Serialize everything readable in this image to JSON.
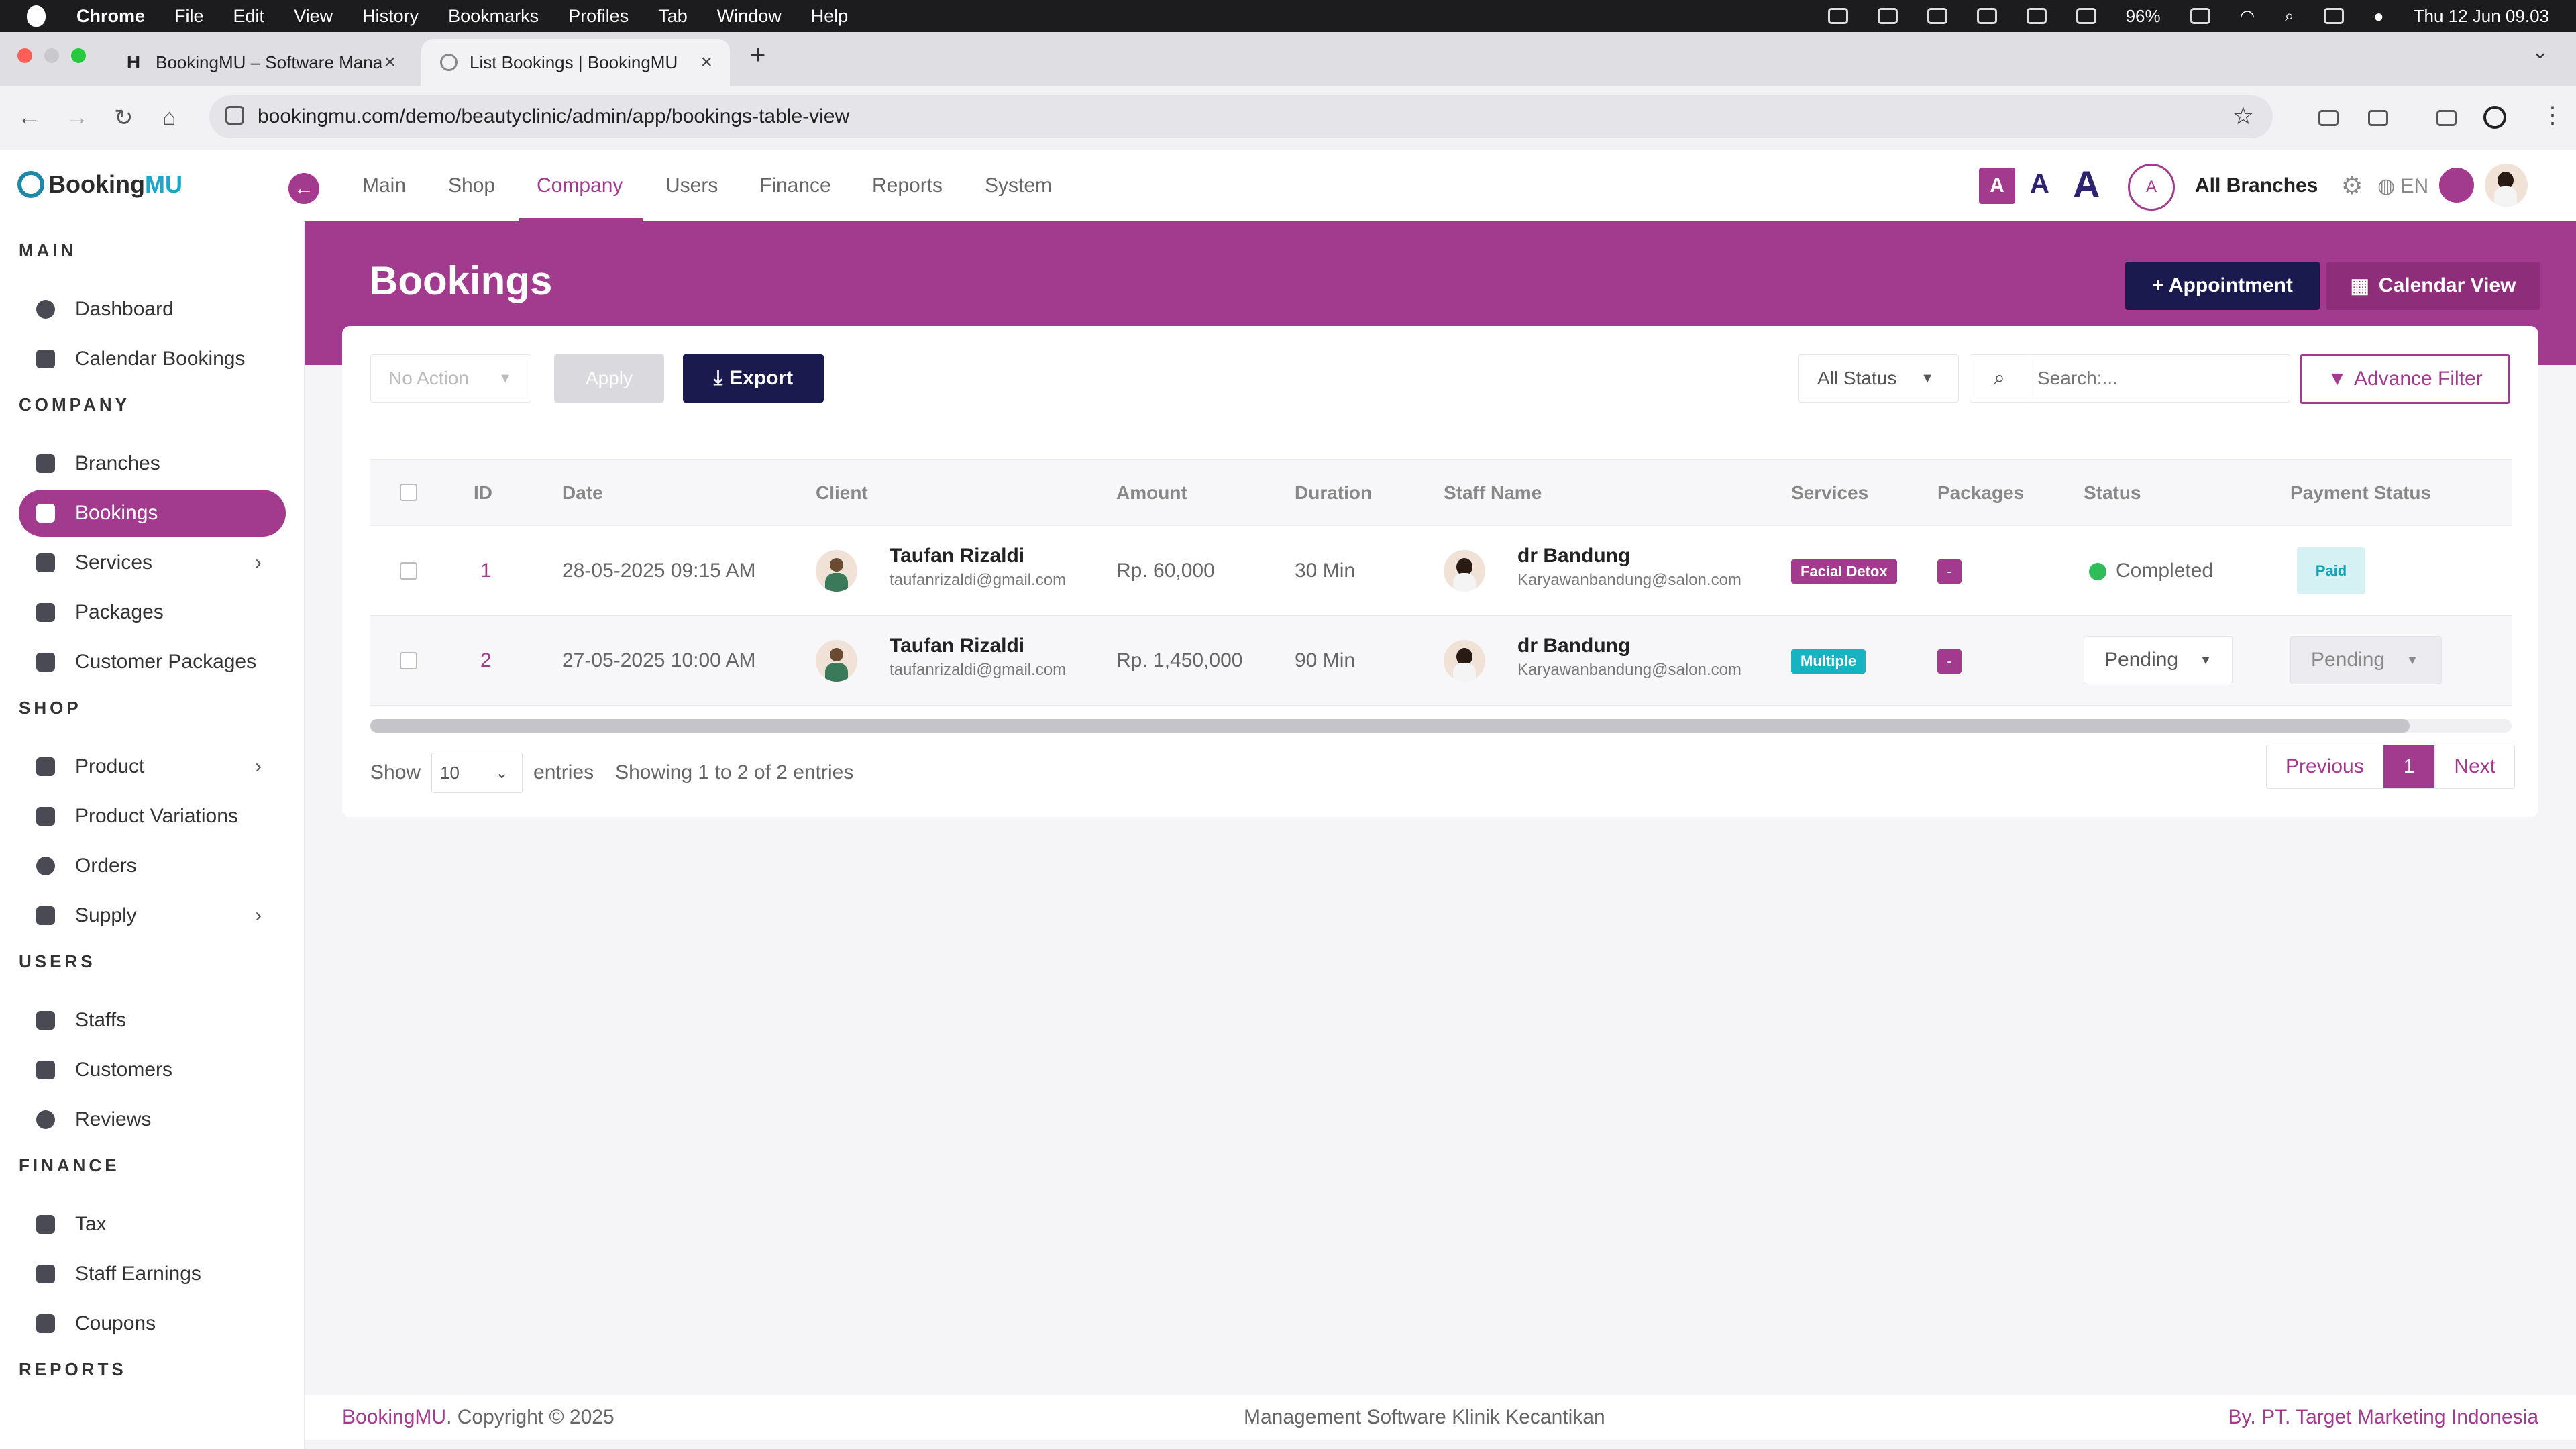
{
  "menubar": {
    "app": "Chrome",
    "items": [
      "File",
      "Edit",
      "View",
      "History",
      "Bookmarks",
      "Profiles",
      "Tab",
      "Window",
      "Help"
    ],
    "battery": "96%",
    "datetime": "Thu 12 Jun  09.03"
  },
  "browser": {
    "tabs": [
      {
        "title": "BookingMU – Software Mana",
        "icon": "H"
      },
      {
        "title": "List Bookings | BookingMU",
        "icon": "globe"
      }
    ],
    "url": "bookingmu.com/demo/beautyclinic/admin/app/bookings-table-view"
  },
  "header": {
    "logo_a": "Booking",
    "logo_b": "MU",
    "nav": [
      "Main",
      "Shop",
      "Company",
      "Users",
      "Finance",
      "Reports",
      "System"
    ],
    "active_nav": "Company",
    "font_sizes": [
      "A",
      "A",
      "A"
    ],
    "branch_initial": "A",
    "branch_label": "All Branches",
    "lang": "EN"
  },
  "sidebar": {
    "sections": [
      {
        "title": "MAIN",
        "items": [
          {
            "label": "Dashboard"
          },
          {
            "label": "Calendar Bookings"
          }
        ]
      },
      {
        "title": "COMPANY",
        "items": [
          {
            "label": "Branches"
          },
          {
            "label": "Bookings",
            "active": true
          },
          {
            "label": "Services",
            "chevron": true
          },
          {
            "label": "Packages"
          },
          {
            "label": "Customer Packages"
          }
        ]
      },
      {
        "title": "SHOP",
        "items": [
          {
            "label": "Product",
            "chevron": true
          },
          {
            "label": "Product Variations"
          },
          {
            "label": "Orders"
          },
          {
            "label": "Supply",
            "chevron": true
          }
        ]
      },
      {
        "title": "USERS",
        "items": [
          {
            "label": "Staffs"
          },
          {
            "label": "Customers"
          },
          {
            "label": "Reviews"
          }
        ]
      },
      {
        "title": "FINANCE",
        "items": [
          {
            "label": "Tax"
          },
          {
            "label": "Staff Earnings"
          },
          {
            "label": "Coupons"
          }
        ]
      },
      {
        "title": "REPORTS",
        "items": []
      }
    ]
  },
  "page": {
    "title": "Bookings",
    "appointment_btn": "+ Appointment",
    "calendar_btn": "Calendar View"
  },
  "toolbar": {
    "bulk_action": "No Action",
    "apply": "Apply",
    "export": "Export",
    "status_filter": "All Status",
    "search_placeholder": "Search:...",
    "advance_filter": "Advance Filter"
  },
  "table": {
    "columns": [
      "ID",
      "Date",
      "Client",
      "Amount",
      "Duration",
      "Staff Name",
      "Services",
      "Packages",
      "Status",
      "Payment Status"
    ],
    "rows": [
      {
        "id": "1",
        "date": "28-05-2025 09:15 AM",
        "client_name": "Taufan Rizaldi",
        "client_email": "taufanrizaldi@gmail.com",
        "amount": "Rp. 60,000",
        "duration": "30 Min",
        "staff_name": "dr Bandung",
        "staff_email": "Karyawanbandung@salon.com",
        "service": "Facial Detox",
        "package": "-",
        "status": "Completed",
        "payment": "Paid"
      },
      {
        "id": "2",
        "date": "27-05-2025 10:00 AM",
        "client_name": "Taufan Rizaldi",
        "client_email": "taufanrizaldi@gmail.com",
        "amount": "Rp. 1,450,000",
        "duration": "90 Min",
        "staff_name": "dr Bandung",
        "staff_email": "Karyawanbandung@salon.com",
        "service": "Multiple",
        "package": "-",
        "status": "Pending",
        "payment": "Pending"
      }
    ]
  },
  "pagination": {
    "show": "Show",
    "page_size": "10",
    "entries": "entries",
    "info": "Showing 1 to 2 of 2 entries",
    "previous": "Previous",
    "current": "1",
    "next": "Next"
  },
  "footer": {
    "left_brand": "BookingMU",
    "left_rest": ". Copyright © 2025",
    "center": "Management Software Klinik Kecantikan",
    "right": "By. PT. Target Marketing Indonesia"
  },
  "colors": {
    "brand": "#a23b8e",
    "navy": "#1a1a4e",
    "teal": "#17b3c2",
    "success": "#2ebd59"
  }
}
